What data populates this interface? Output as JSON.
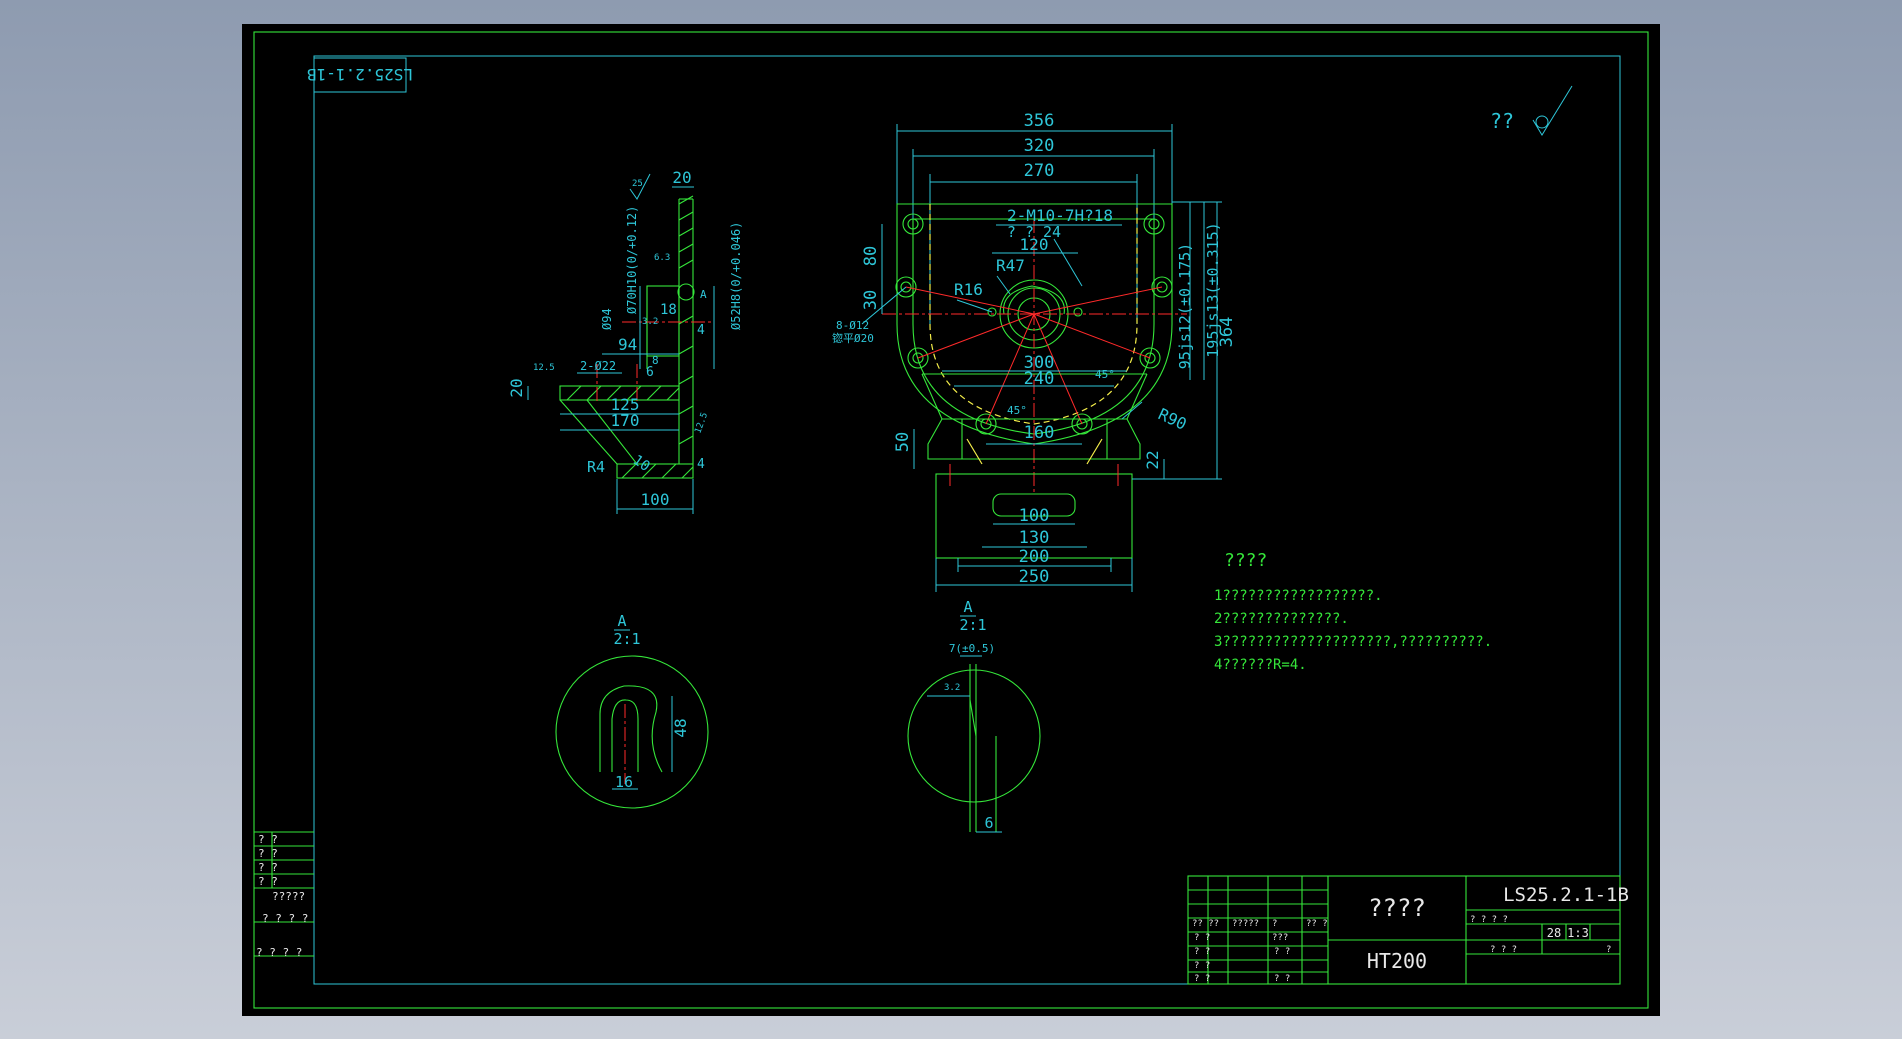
{
  "drawing": {
    "corner_tag": "LS25.2.1-1B",
    "roughness_note": "??",
    "front_view": {
      "dims_top": [
        "356",
        "320",
        "270"
      ],
      "thread_note": "2-M10-7H?18",
      "thread_note2": "? ? 24",
      "dim_120": "120",
      "radii": [
        "R47",
        "R16",
        "R90"
      ],
      "hole_note": "8-Ø12",
      "hole_note2": "锪平Ø20",
      "dims_left": [
        "80",
        "30"
      ],
      "dims_mid": [
        "300",
        "240",
        "160"
      ],
      "angle_45a": "45°",
      "angle_45b": "45°",
      "dims_right": [
        "195js13(±0.315)",
        "95js12(±0.175)",
        "364"
      ],
      "dims_low": [
        "50",
        "22"
      ],
      "dims_bottom": [
        "100",
        "130",
        "200",
        "250"
      ]
    },
    "side_view": {
      "dims": [
        "20",
        "94",
        "125",
        "170",
        "100",
        "20",
        "4",
        "4",
        "18",
        "6",
        "8",
        "R4",
        "10"
      ],
      "bore_notes": [
        "Ø94",
        "Ø70H10(0/+0.12)",
        "Ø52H8(0/+0.046)"
      ],
      "hole_note": "2-Ø22",
      "roughness": [
        "25",
        "6.3",
        "3.2",
        "12.5",
        "12.5"
      ],
      "section_mark": "A"
    },
    "detail_a1": {
      "label": "A",
      "scale": "2:1",
      "dims": [
        "48",
        "16"
      ]
    },
    "detail_a2": {
      "label": "A",
      "scale": "2:1",
      "dims": [
        "7(±0.5)",
        "6",
        "3.2"
      ]
    },
    "notes": {
      "title": "????",
      "lines": [
        "1??????????????????.",
        "2??????????????.",
        "3????????????????????,??????????.",
        "4??????R=4."
      ]
    },
    "left_table": {
      "rows": [
        "? ?",
        "? ?",
        "? ?",
        "? ?",
        "?????",
        "? ? ? ?",
        "? ? ?  ?"
      ]
    },
    "title_block": {
      "part_name": "????",
      "drawing_no": "LS25.2.1-1B",
      "material": "HT200",
      "count": "28",
      "scale": "1:3",
      "small_labels": [
        "?? ??",
        "?????",
        "?",
        "?? ?",
        "? ?",
        "???",
        "? ?",
        "? ?",
        "? ?",
        "? ?",
        "? ?",
        "? ?  ? ?",
        "? ? ?",
        "?"
      ]
    }
  },
  "colors": {
    "line": "#35e63a",
    "dim": "#2ec6d8",
    "center": "#ff2a2a",
    "hidden": "#f4ee4a",
    "text": "#e8e8e8",
    "bg": "#000000"
  }
}
